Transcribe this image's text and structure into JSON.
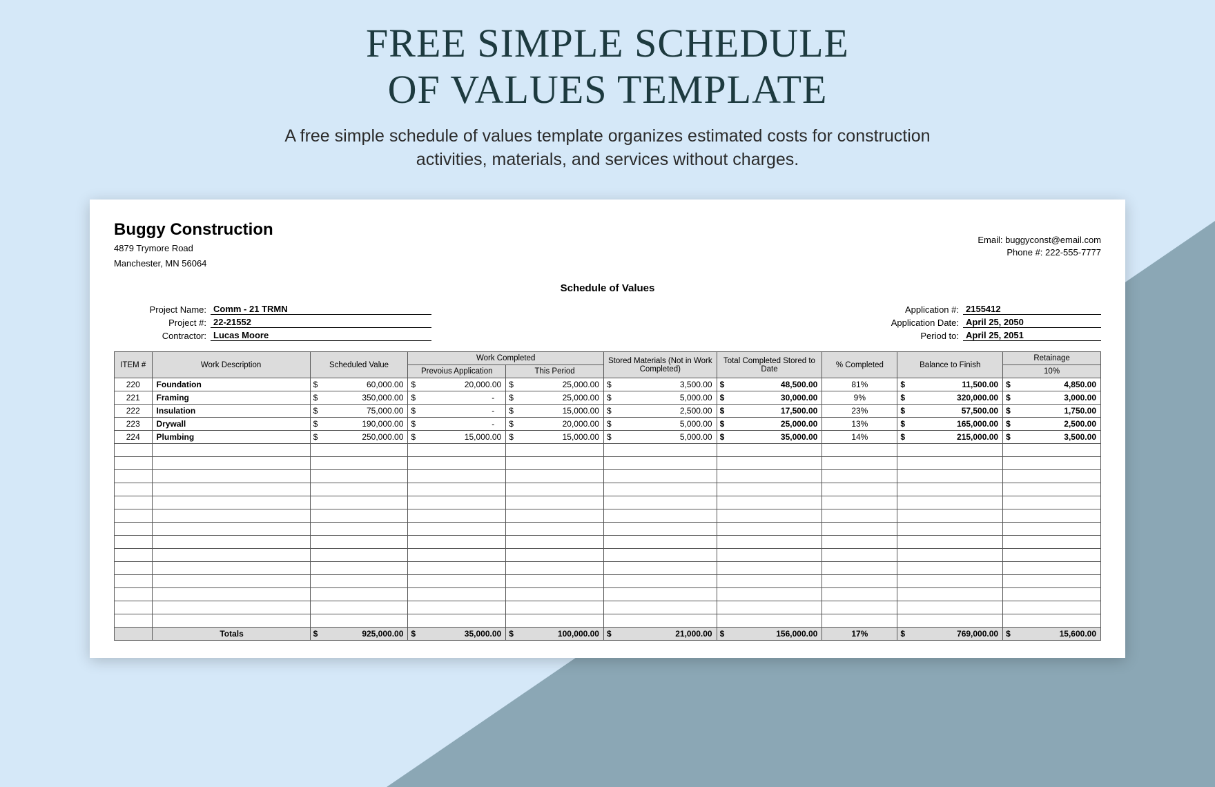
{
  "hero": {
    "title_line1": "FREE SIMPLE SCHEDULE",
    "title_line2": "OF VALUES TEMPLATE",
    "subtitle_line1": "A free simple schedule of values template organizes estimated costs for construction",
    "subtitle_line2": "activities, materials, and services without charges."
  },
  "company": {
    "name": "Buggy Construction",
    "addr1": "4879 Trymore Road",
    "addr2": "Manchester, MN 56064",
    "email": "Email: buggyconst@email.com",
    "phone": "Phone #: 222-555-7777"
  },
  "doc_title": "Schedule of Values",
  "meta_left": {
    "project_name_label": "Project Name:",
    "project_name": "Comm - 21 TRMN",
    "project_num_label": "Project #:",
    "project_num": "22-21552",
    "contractor_label": "Contractor:",
    "contractor": "Lucas Moore"
  },
  "meta_right": {
    "app_num_label": "Application #:",
    "app_num": "2155412",
    "app_date_label": "Application Date:",
    "app_date": "April 25, 2050",
    "period_label": "Period to:",
    "period": "April 25, 2051"
  },
  "headers": {
    "item": "ITEM #",
    "desc": "Work Description",
    "sched": "Scheduled Value",
    "work_completed": "Work Completed",
    "prev": "Prevoius Application",
    "this": "This Period",
    "stored": "Stored Materials (Not in Work Completed)",
    "total": "Total Completed Stored to Date",
    "pct": "% Completed",
    "bal": "Balance to Finish",
    "ret_top": "Retainage",
    "ret_bot": "10%"
  },
  "rows": [
    {
      "item": "220",
      "desc": "Foundation",
      "sched": "60,000.00",
      "prev": "20,000.00",
      "this": "25,000.00",
      "stored": "3,500.00",
      "total": "48,500.00",
      "pct": "81%",
      "bal": "11,500.00",
      "ret": "4,850.00"
    },
    {
      "item": "221",
      "desc": "Framing",
      "sched": "350,000.00",
      "prev": "-",
      "this": "25,000.00",
      "stored": "5,000.00",
      "total": "30,000.00",
      "pct": "9%",
      "bal": "320,000.00",
      "ret": "3,000.00"
    },
    {
      "item": "222",
      "desc": "Insulation",
      "sched": "75,000.00",
      "prev": "-",
      "this": "15,000.00",
      "stored": "2,500.00",
      "total": "17,500.00",
      "pct": "23%",
      "bal": "57,500.00",
      "ret": "1,750.00"
    },
    {
      "item": "223",
      "desc": "Drywall",
      "sched": "190,000.00",
      "prev": "-",
      "this": "20,000.00",
      "stored": "5,000.00",
      "total": "25,000.00",
      "pct": "13%",
      "bal": "165,000.00",
      "ret": "2,500.00"
    },
    {
      "item": "224",
      "desc": "Plumbing",
      "sched": "250,000.00",
      "prev": "15,000.00",
      "this": "15,000.00",
      "stored": "5,000.00",
      "total": "35,000.00",
      "pct": "14%",
      "bal": "215,000.00",
      "ret": "3,500.00"
    }
  ],
  "empty_rows": 14,
  "totals": {
    "label": "Totals",
    "sched": "925,000.00",
    "prev": "35,000.00",
    "this": "100,000.00",
    "stored": "21,000.00",
    "total": "156,000.00",
    "pct": "17%",
    "bal": "769,000.00",
    "ret": "15,600.00"
  }
}
